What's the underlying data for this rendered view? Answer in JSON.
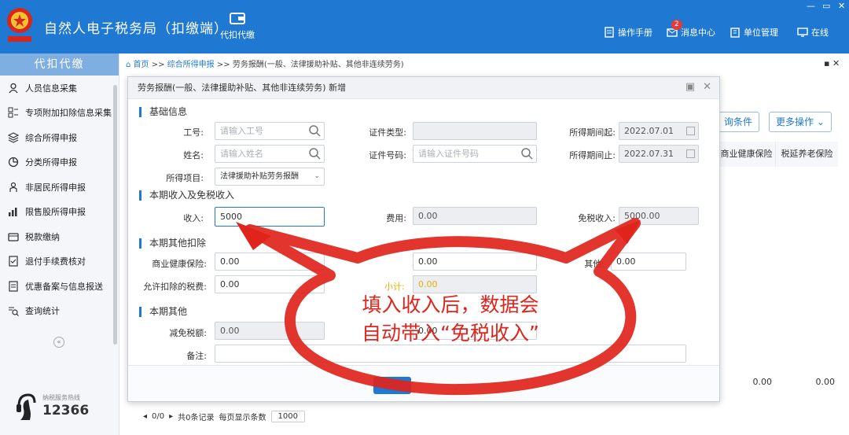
{
  "app": {
    "title": "自然人电子税务局（扣缴端）",
    "emblem_text": "国家税务总局"
  },
  "top_tab": {
    "label": "代扣代缴"
  },
  "top_tools": {
    "manual": "操作手册",
    "messages": "消息中心",
    "messages_badge": "2",
    "unit_mgmt": "单位管理",
    "online": "在线"
  },
  "sidebar": {
    "header": "代扣代缴",
    "items": [
      {
        "label": "人员信息采集",
        "icon": "person-icon"
      },
      {
        "label": "专项附加扣除信息采集",
        "icon": "grid-icon"
      },
      {
        "label": "综合所得申报",
        "icon": "layers-icon"
      },
      {
        "label": "分类所得申报",
        "icon": "pie-icon"
      },
      {
        "label": "非居民所得申报",
        "icon": "person-outline-icon"
      },
      {
        "label": "限售股所得申报",
        "icon": "bar-chart-icon"
      },
      {
        "label": "税款缴纳",
        "icon": "wallet-icon"
      },
      {
        "label": "退付手续费核对",
        "icon": "document-check-icon"
      },
      {
        "label": "优惠备案与信息报送",
        "icon": "document-icon"
      },
      {
        "label": "查询统计",
        "icon": "search-list-icon"
      }
    ],
    "hotline_label": "纳税服务热线",
    "hotline_number": "12366"
  },
  "breadcrumb": {
    "home": "首页",
    "sep1": ">>",
    "parent": "综合所得申报",
    "sep2": ">>",
    "current": "劳务报酬(一般、法律援助补贴、其他非连续劳务)"
  },
  "background": {
    "buttons": {
      "conditions": "询条件",
      "more_ops": "更多操作"
    },
    "columns": [
      "商业健康保险",
      "税延养老保险"
    ],
    "totals": [
      "0.00",
      "0.00"
    ],
    "pager": {
      "range": "0/0",
      "records": "共0条记录",
      "per_page_label": "每页显示条数",
      "per_page": "1000"
    }
  },
  "modal": {
    "title": "劳务报酬(一般、法律援助补贴、其他非连续劳务) 新增",
    "basic": {
      "section": "基础信息",
      "id_no": {
        "label": "工号:",
        "placeholder": "请输入工号"
      },
      "cert_type": {
        "label": "证件类型:",
        "value": ""
      },
      "period_start": {
        "label": "所得期间起:",
        "value": "2022.07.01"
      },
      "name": {
        "label": "姓名:",
        "placeholder": "请输入姓名"
      },
      "cert_no": {
        "label": "证件号码:",
        "placeholder": "请输入证件号码"
      },
      "period_end": {
        "label": "所得期间止:",
        "value": "2022.07.31"
      },
      "income_item": {
        "label": "所得项目:",
        "value": "法律援助补贴劳务报酬"
      }
    },
    "income": {
      "section": "本期收入及免税收入",
      "income": {
        "label": "收入:",
        "value": "5000"
      },
      "cost": {
        "label": "费用:",
        "value": "0.00"
      },
      "tax_free": {
        "label": "免税收入:",
        "value": "5000.00"
      }
    },
    "deductions": {
      "section": "本期其他扣除",
      "health_ins": {
        "label": "商业健康保险:",
        "value": "0.00"
      },
      "mid_value": "0.00",
      "other": {
        "label": "其他:",
        "value": "0.00"
      },
      "allowed_tax": {
        "label": "允许扣除的税费:",
        "value": "0.00"
      },
      "subtotal": {
        "label": "小计:",
        "value": "0.00"
      }
    },
    "other": {
      "section": "本期其他",
      "tax_reduction": {
        "label": "减免税额:",
        "value": "0.00"
      },
      "mid_value": "0.00",
      "remark": {
        "label": "备注:",
        "value": ""
      }
    }
  },
  "annotation": {
    "line1": "填入收入后，数据会",
    "line2": "自动带入“免税收入”"
  },
  "colors": {
    "brand": "#1f78d1",
    "annotation": "#e0241b"
  }
}
